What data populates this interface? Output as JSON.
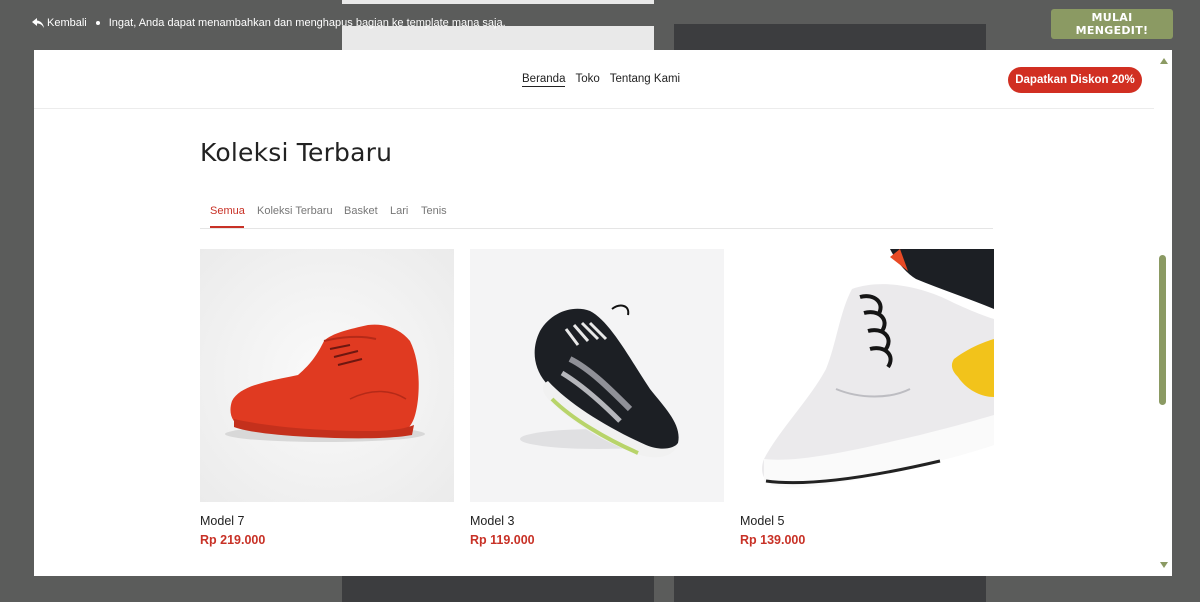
{
  "editor": {
    "back_label": "Kembali",
    "notice": "Ingat, Anda dapat menambahkan dan menghapus bagian ke template mana saja.",
    "start_button": "MULAI MENGEDIT!"
  },
  "site": {
    "nav": [
      "Beranda",
      "Toko",
      "Tentang Kami"
    ],
    "discount_button": "Dapatkan Diskon 20%"
  },
  "section": {
    "title": "Koleksi Terbaru",
    "tabs": [
      "Semua",
      "Koleksi Terbaru",
      "Basket",
      "Lari",
      "Tenis"
    ],
    "active_tab": "Semua"
  },
  "products": [
    {
      "name": "Model 7",
      "price": "Rp 219.000"
    },
    {
      "name": "Model 3",
      "price": "Rp 119.000"
    },
    {
      "name": "Model 5",
      "price": "Rp 139.000"
    }
  ],
  "colors": {
    "accent": "#8b9a63",
    "brand_red": "#d12f22",
    "price_red": "#c83126"
  }
}
